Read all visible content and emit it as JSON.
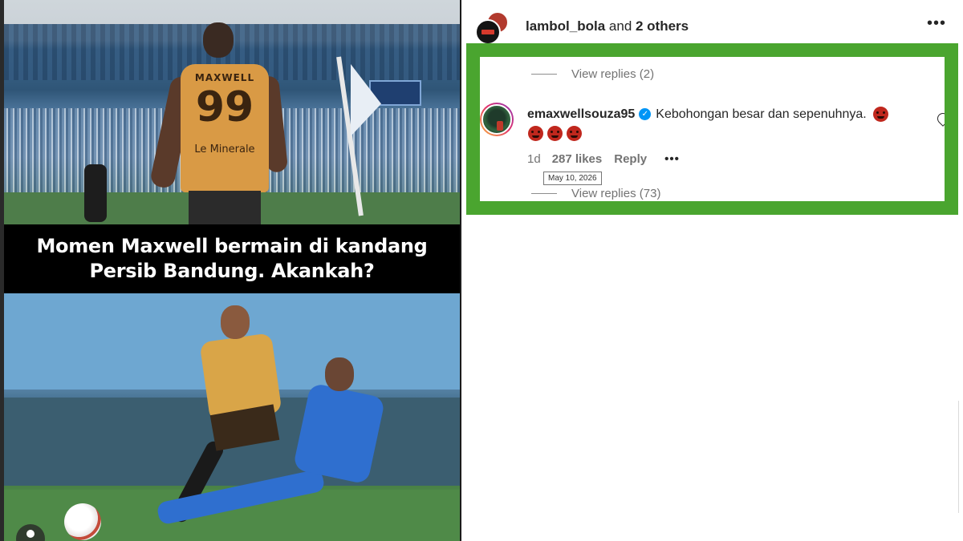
{
  "post": {
    "caption_line1": "Momen Maxwell bermain di kandang",
    "caption_line2": "Persib Bandung. Akankah?",
    "jersey_name": "MAXWELL",
    "jersey_number": "99",
    "jersey_sponsor": "Le Minerale"
  },
  "header": {
    "username": "lambol_bola",
    "connector": " and ",
    "others": "2 others",
    "more_icon": "•••"
  },
  "comments": {
    "view_replies_top": "View replies (2)",
    "main": {
      "username": "emaxwellsouza95",
      "verified_icon": "✓",
      "text": "Kebohongan besar dan sepenuhnya.",
      "time": "1d",
      "likes": "287 likes",
      "reply_label": "Reply",
      "more_icon": "•••",
      "tooltip": "May 10, 2026"
    },
    "view_replies_bottom": "View replies (73)"
  },
  "colors": {
    "highlight_border": "#4aa52f",
    "verified_badge": "#0095f6",
    "story_ring": "#e1306c"
  }
}
